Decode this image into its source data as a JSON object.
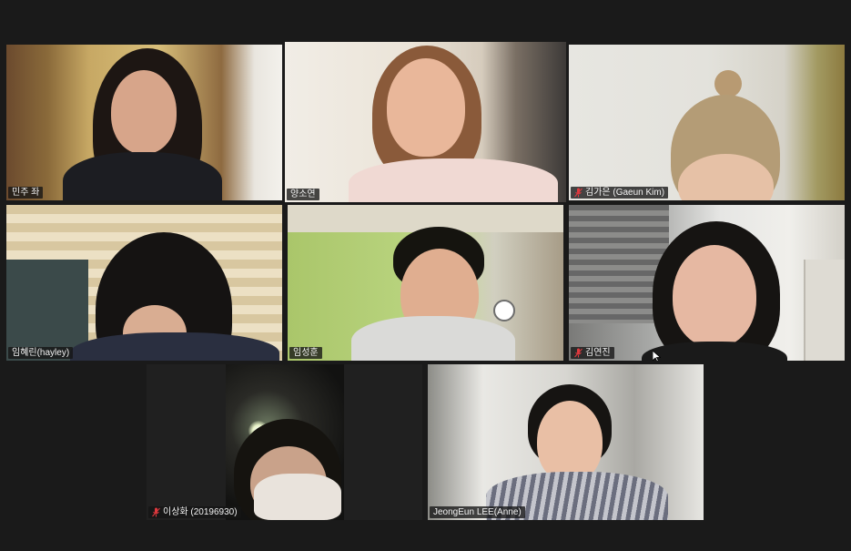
{
  "meeting": {
    "participants": [
      {
        "name": "민주 좌",
        "muted": false,
        "active": false
      },
      {
        "name": "양소연",
        "muted": false,
        "active": true
      },
      {
        "name": "김가은 (Gaeun Kim)",
        "muted": true,
        "active": false
      },
      {
        "name": "임혜린(hayley)",
        "muted": false,
        "active": false
      },
      {
        "name": "임성훈",
        "muted": false,
        "active": false
      },
      {
        "name": "김연진",
        "muted": true,
        "active": false
      },
      {
        "name": "이상화 (20196930)",
        "muted": true,
        "active": false
      },
      {
        "name": "JeongEun LEE(Anne)",
        "muted": false,
        "active": false
      }
    ]
  },
  "colors": {
    "background": "#1a1a1a",
    "active_speaker_border": "#c8e66a",
    "muted_icon": "#e0393e"
  },
  "icons": {
    "muted": "mic-muted-icon"
  }
}
